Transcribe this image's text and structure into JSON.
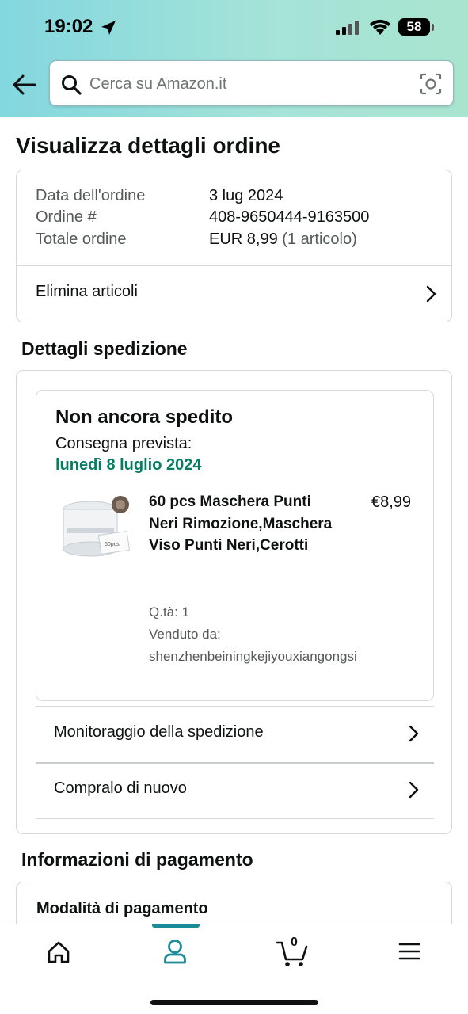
{
  "status_bar": {
    "time": "19:02",
    "battery": "58"
  },
  "search": {
    "placeholder": "Cerca su Amazon.it"
  },
  "page": {
    "title": "Visualizza dettagli ordine"
  },
  "order": {
    "date_label": "Data dell'ordine",
    "date_value": "3 lug 2024",
    "number_label": "Ordine #",
    "number_value": "408-9650444-9163500",
    "total_label": "Totale ordine",
    "total_value": "EUR 8,99",
    "total_items": "(1 articolo)",
    "delete_items_label": "Elimina articoli"
  },
  "shipping": {
    "section_title": "Dettagli spedizione",
    "status": "Non ancora spedito",
    "delivery_label": "Consegna prevista:",
    "delivery_date": "lunedì 8 luglio 2024",
    "product": {
      "title": "60 pcs Maschera Punti Neri Rimozione,Maschera Viso Punti Neri,Cerotti",
      "price": "€8,99",
      "quantity": "Q.tà: 1",
      "sold_by_label": "Venduto da:",
      "seller": "shenzhenbeiningkejiyouxiangongsi",
      "image_label": "60pcs"
    },
    "track_label": "Monitoraggio della spedizione",
    "buy_again_label": "Compralo di nuovo"
  },
  "payment": {
    "section_title": "Informazioni di pagamento",
    "method_label": "Modalità di pagamento"
  },
  "bottom_nav": {
    "cart_count": "0",
    "accent_color": "#1b8a99"
  },
  "colors": {
    "delivery_green": "#067d62",
    "header_gradient_start": "#83d7df",
    "header_gradient_end": "#a9e4cf"
  },
  "icons": [
    "location-arrow-icon",
    "signal-icon",
    "wifi-icon",
    "battery-icon",
    "back-arrow-icon",
    "search-icon",
    "camera-icon",
    "chevron-right-icon",
    "home-icon",
    "account-icon",
    "cart-icon",
    "menu-icon"
  ]
}
